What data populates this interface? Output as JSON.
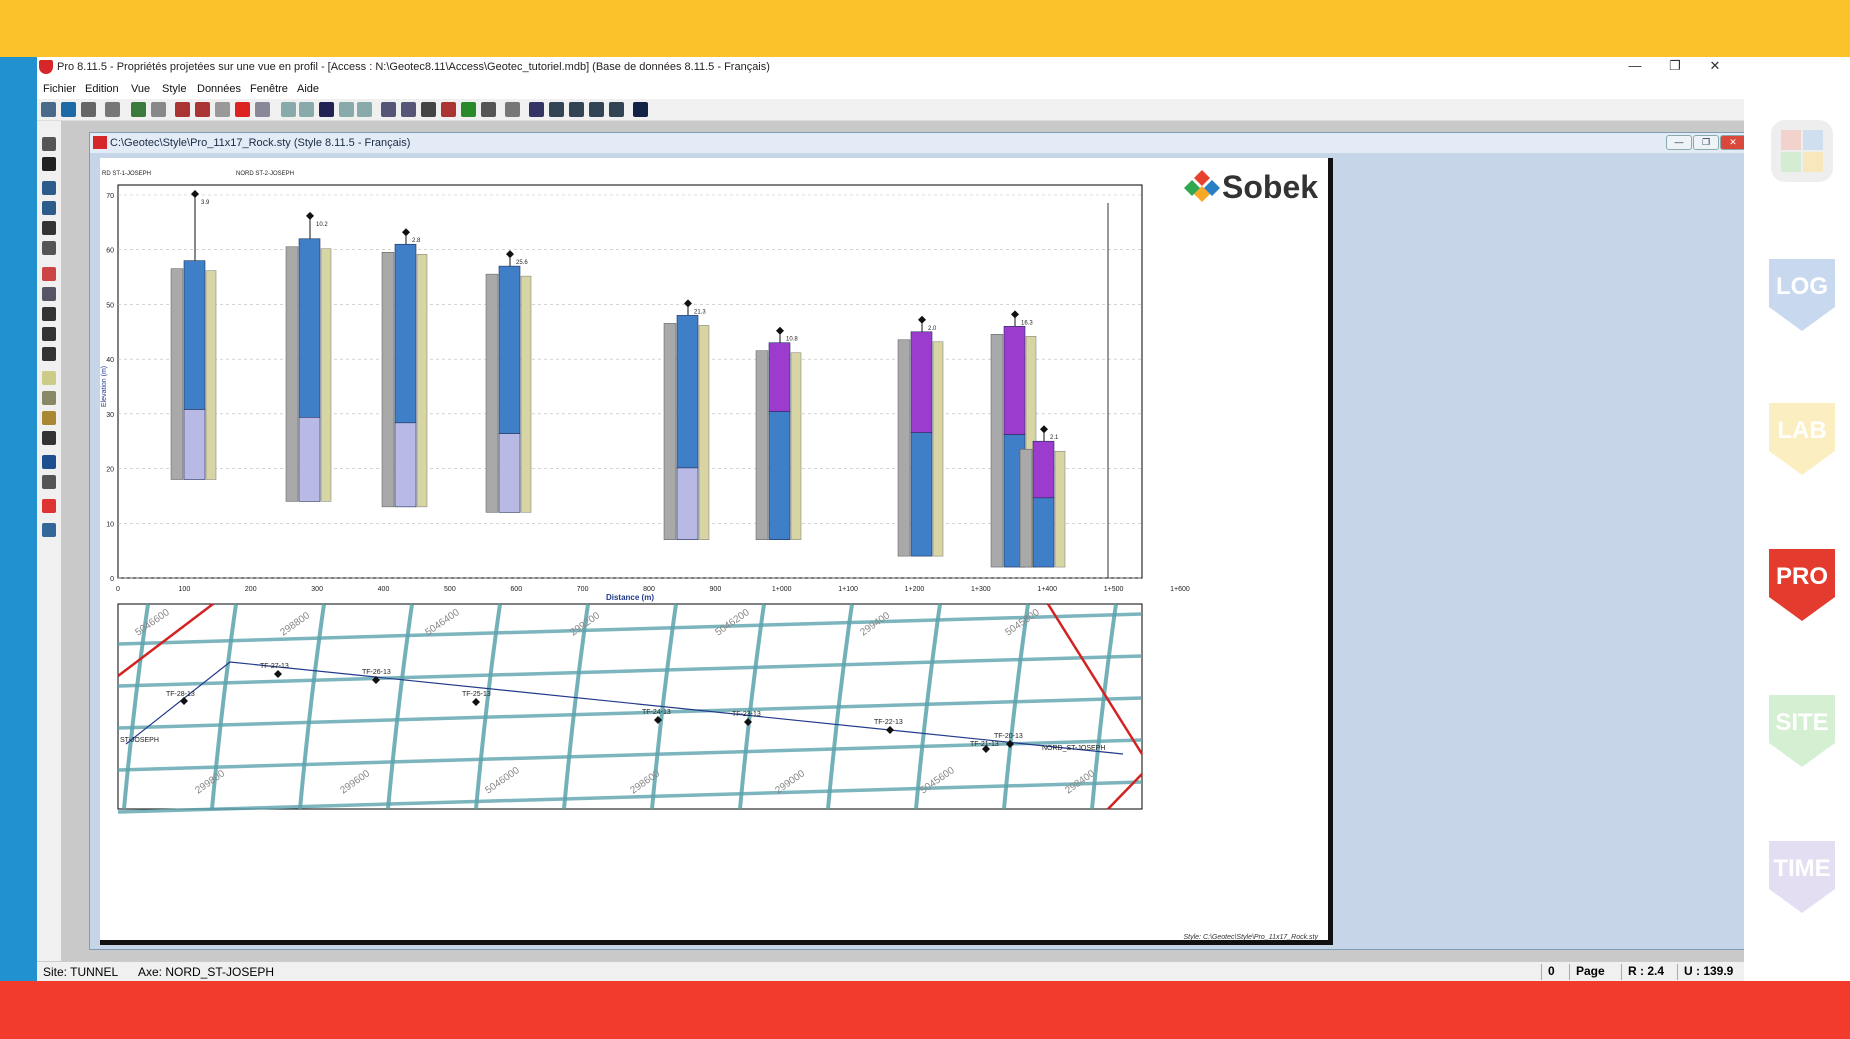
{
  "window": {
    "title": "Pro 8.11.5 - Propriétés projetées sur une vue en profil - [Access : N:\\Geotec8.11\\Access\\Geotec_tutoriel.mdb] (Base de données 8.11.5 - Français)",
    "minimize": "—",
    "restore": "❐",
    "close": "✕"
  },
  "menu": [
    "Fichier",
    "Edition",
    "Vue",
    "Style",
    "Données",
    "Fenêtre",
    "Aide"
  ],
  "document": {
    "title": "C:\\Geotec\\Style\\Pro_11x17_Rock.sty (Style 8.11.5 - Français)",
    "logo_text": "Sobek",
    "style_footer": "Style: C:\\Geotec\\Style\\Pro_11x17_Rock.sty"
  },
  "profile": {
    "ylabel": "Elevation (m)",
    "xlabel": "Distance (m)",
    "y_ticks": [
      "0",
      "10",
      "20",
      "30",
      "40",
      "50",
      "60",
      "70"
    ],
    "x_ticks": [
      "0",
      "100",
      "200",
      "300",
      "400",
      "500",
      "600",
      "700",
      "800",
      "900",
      "1+000",
      "1+100",
      "1+200",
      "1+300",
      "1+400",
      "1+500",
      "1+600"
    ],
    "section_left": "RD ST-1-JOSEPH",
    "section_right": "NORD ST-2-JOSEPH",
    "boreholes": [
      {
        "top_elev": 68,
        "bottom_elev": 18,
        "col_top": 58,
        "value": "3.9"
      },
      {
        "top_elev": 64,
        "bottom_elev": 14,
        "col_top": 62,
        "value": "10.2"
      },
      {
        "top_elev": 61,
        "bottom_elev": 13,
        "col_top": 61,
        "value": "2.8"
      },
      {
        "top_elev": 57,
        "bottom_elev": 12,
        "col_top": 57,
        "value": "25.6"
      },
      {
        "top_elev": 48,
        "bottom_elev": 7,
        "col_top": 48,
        "value": "21.3"
      },
      {
        "top_elev": 43,
        "bottom_elev": 7,
        "col_top": 43,
        "value": "10.8"
      },
      {
        "top_elev": 45,
        "bottom_elev": 4,
        "col_top": 45,
        "value": "2.0"
      },
      {
        "top_elev": 46,
        "bottom_elev": 2,
        "col_top": 46,
        "value": "16.3"
      },
      {
        "top_elev": 25,
        "bottom_elev": 2,
        "col_top": 25,
        "value": "2.1"
      }
    ]
  },
  "plan": {
    "labels": [
      "TF-28-13",
      "TF-27-13",
      "TF-26-13",
      "TF-25-13",
      "TF-24-13",
      "TF-23-13",
      "TF-22-13",
      "TF-21-13",
      "TF-20-13",
      "NORD_ST-JOSEPH",
      "ST-JOSEPH"
    ],
    "grid_labels": [
      "5046600",
      "298800",
      "5046400",
      "299200",
      "5046200",
      "299400",
      "5045800",
      "299800",
      "299600",
      "5046000",
      "298600",
      "299000",
      "5045600",
      "298400"
    ]
  },
  "status": {
    "site": "Site: TUNNEL",
    "axis": "Axe: NORD_ST-JOSEPH",
    "count": "0",
    "page": "Page",
    "r": "R : 2.4",
    "u": "U : 139.9"
  },
  "side_badges": [
    {
      "label": "LOG",
      "color": "#c8d8ee"
    },
    {
      "label": "LAB",
      "color": "#fbeec1"
    },
    {
      "label": "PRO",
      "color": "#e33b2e"
    },
    {
      "label": "SITE",
      "color": "#d5efd3"
    },
    {
      "label": "TIME",
      "color": "#e3def2"
    }
  ],
  "colors": {
    "top_band": "#fcc22c",
    "bottom_band": "#f23b2c",
    "left_strip": "#2191cf",
    "plan_streets": "#5ba3ad",
    "profile_blue": "#3f7fc7",
    "profile_purple": "#9b3ccf"
  }
}
